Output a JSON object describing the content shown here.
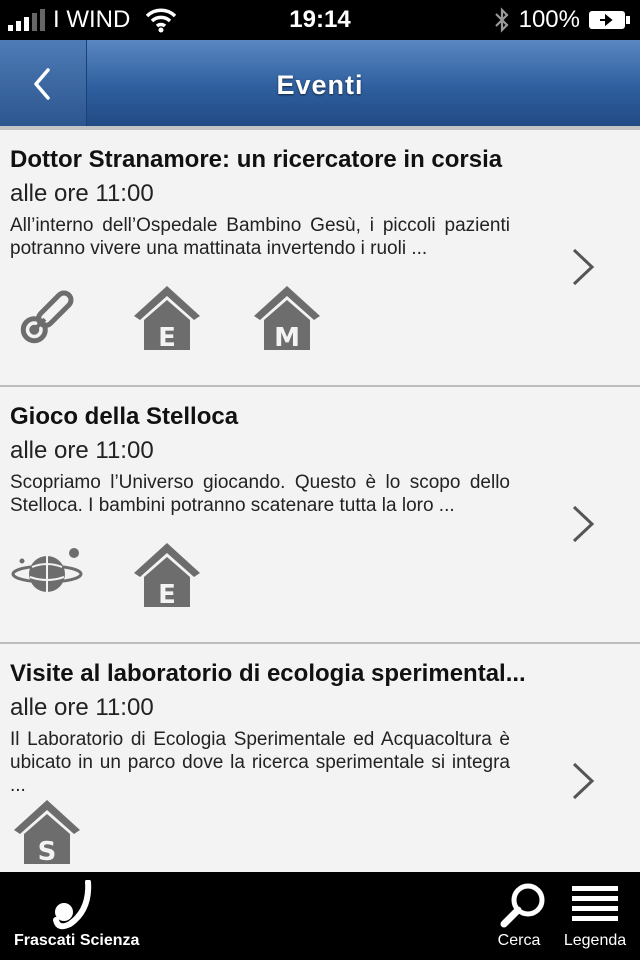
{
  "status_bar": {
    "carrier": "I WIND",
    "time": "19:14",
    "battery": "100%"
  },
  "nav": {
    "title": "Eventi"
  },
  "events": [
    {
      "title": "Dottor Stranamore: un ricercatore in corsia",
      "time": "alle ore 11:00",
      "description": "All’interno dell’Ospedale Bambino Gesù, i piccoli pazienti potranno vivere una mattinata invertendo i ruoli ...",
      "icons": [
        "thermometer-icon",
        "house-e-icon",
        "house-m-icon"
      ]
    },
    {
      "title": "Gioco della Stelloca",
      "time": "alle ore 11:00",
      "description": "Scopriamo l’Universo giocando. Questo è lo scopo dello Stelloca. I bambini potranno scatenare tutta la loro ...",
      "icons": [
        "planet-icon",
        "house-e-icon"
      ]
    },
    {
      "title": "Visite al laboratorio di ecologia sperimental...",
      "time": "alle ore 11:00",
      "description": "Il Laboratorio di Ecologia Sperimentale ed Acquacoltura è ubicato in un parco dove la ricerca sperimentale si integra ...",
      "icons": [
        "house-s-icon"
      ]
    }
  ],
  "tab_bar": {
    "logo_label": "Frascati Scienza",
    "search_label": "Cerca",
    "legend_label": "Legenda"
  },
  "colors": {
    "nav_blue": "#2f5f9f",
    "icon_gray": "#6d6d6d"
  }
}
